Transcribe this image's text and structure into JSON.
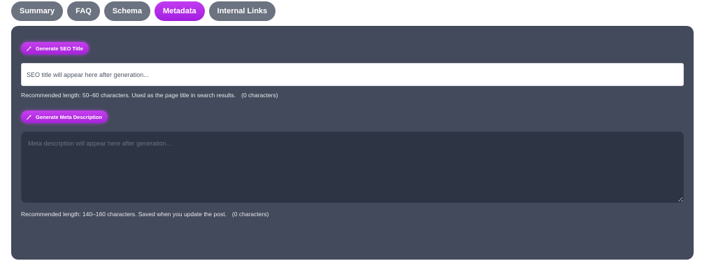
{
  "tabs": [
    {
      "label": "Summary",
      "active": false
    },
    {
      "label": "FAQ",
      "active": false
    },
    {
      "label": "Schema",
      "active": false
    },
    {
      "label": "Metadata",
      "active": true
    },
    {
      "label": "Internal Links",
      "active": false
    }
  ],
  "colors": {
    "accent": "#b02fe6",
    "tab_inactive": "#6b7280",
    "panel_bg": "#434a5b",
    "textarea_bg": "#2d3444"
  },
  "seo_title": {
    "button_label": "Generate SEO Title",
    "button_icon": "magic-wand-icon",
    "value": "",
    "placeholder": "SEO title will appear here after generation...",
    "hint": "Recommended length: 50–60 characters. Used as the page title in search results.",
    "count": "(0 characters)"
  },
  "meta_description": {
    "button_label": "Generate Meta Description",
    "button_icon": "magic-wand-icon",
    "value": "",
    "placeholder": "Meta description will appear here after generation...",
    "hint": "Recommended length: 140–160 characters. Saved when you update the post.",
    "count": "(0 characters)"
  }
}
